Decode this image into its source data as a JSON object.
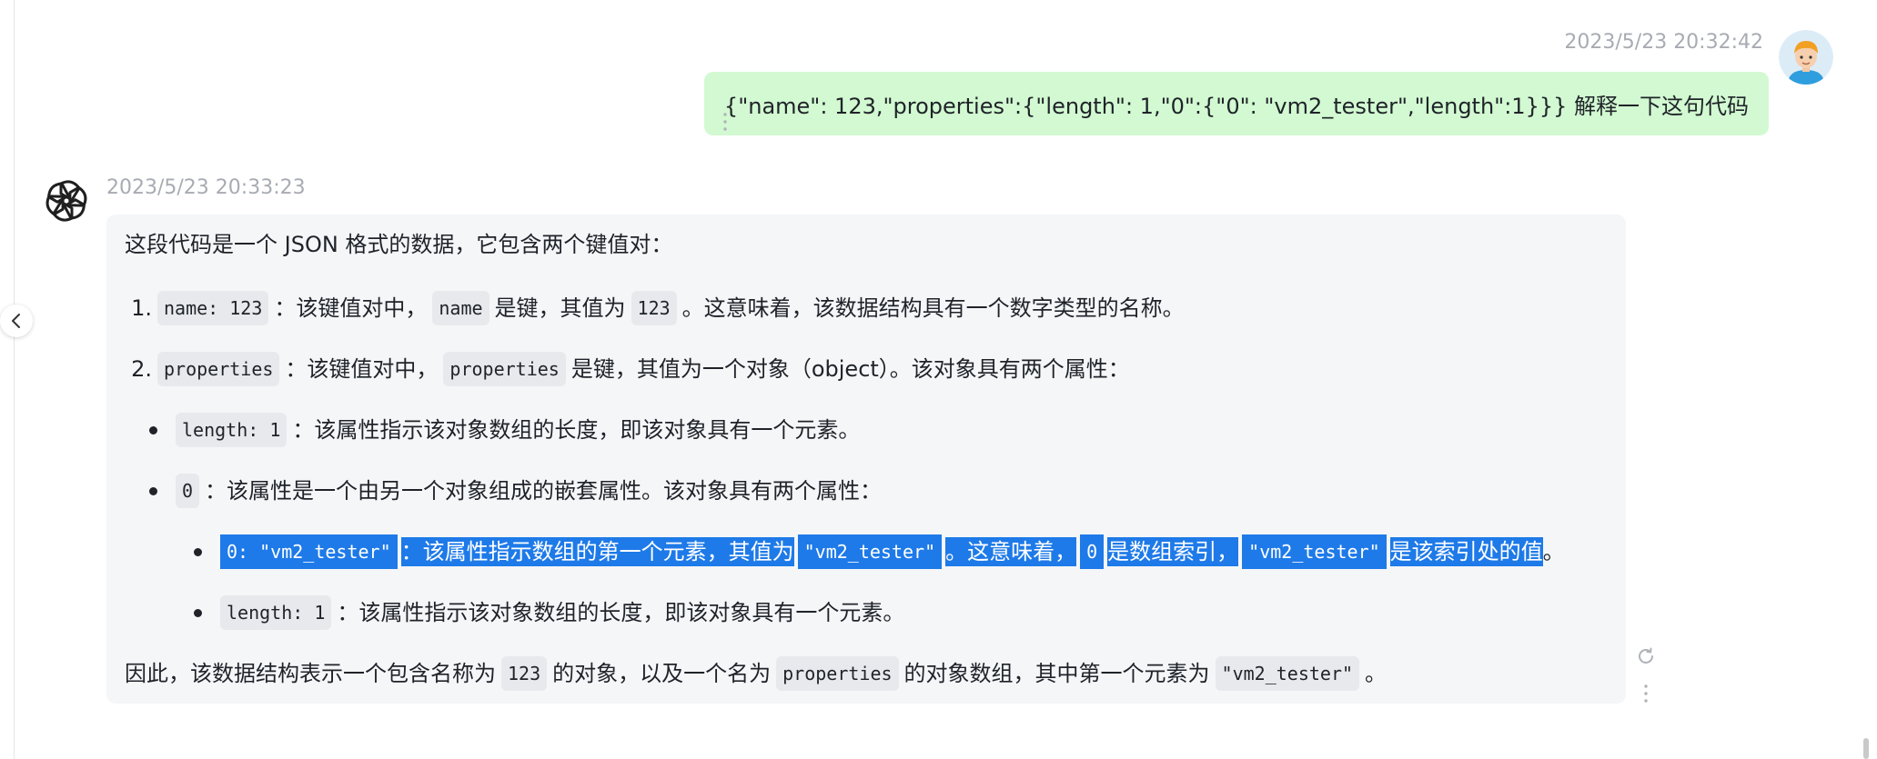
{
  "user_message": {
    "timestamp": "2023/5/23 20:32:42",
    "text": "{\"name\": 123,\"properties\":{\"length\": 1,\"0\":{\"0\": \"vm2_tester\",\"length\":1}}}  解释一下这句代码",
    "avatar_icon": "user-avatar-icon"
  },
  "assistant_message": {
    "timestamp": "2023/5/23 20:33:23",
    "intro": "这段代码是一个 JSON 格式的数据，它包含两个键值对：",
    "item1": {
      "num": "1.",
      "code_key": "name: 123",
      "t1": "：该键值对中，",
      "code_name": "name",
      "t2": "是键，其值为",
      "code_val": "123",
      "t3": "。这意味着，该数据结构具有一个数字类型的名称。"
    },
    "item2": {
      "num": "2.",
      "code_key": "properties",
      "t1": "：该键值对中，",
      "code_name": "properties",
      "t2": "是键，其值为一个对象（object）。该对象具有两个属性："
    },
    "bullet1": {
      "code": "length: 1",
      "text": "：该属性指示该对象数组的长度，即该对象具有一个元素。"
    },
    "bullet2": {
      "code": "0",
      "text": "：该属性是一个由另一个对象组成的嵌套属性。该对象具有两个属性："
    },
    "sub1": {
      "code_key": "0: \"vm2_tester\"",
      "t1": "：该属性指示数组的第一个元素，其值为",
      "code_val": "\"vm2_tester\"",
      "t2": "。这意味着，",
      "code_zero": "0",
      "t3": "是数组索引，",
      "code_val2": "\"vm2_tester\"",
      "t4": "是该索引处的值",
      "t5": "。"
    },
    "sub2": {
      "code": "length: 1",
      "text": "：该属性指示该对象数组的长度，即该对象具有一个元素。"
    },
    "conclusion": {
      "t1": "因此，该数据结构表示一个包含名称为",
      "code1": "123",
      "t2": "的对象，以及一个名为",
      "code2": "properties",
      "t3": "的对象数组，其中第一个元素为",
      "code3": "\"vm2_tester\"",
      "t4": "。"
    }
  },
  "icons": {
    "collapse": "chevron-left-icon",
    "regenerate": "refresh-icon",
    "more": "more-vertical-icon",
    "assistant_logo": "openai-logo-icon"
  },
  "colors": {
    "user_bubble": "#d2f9d1",
    "assistant_bubble": "#f4f6f8",
    "selection": "#1e7ae8"
  }
}
